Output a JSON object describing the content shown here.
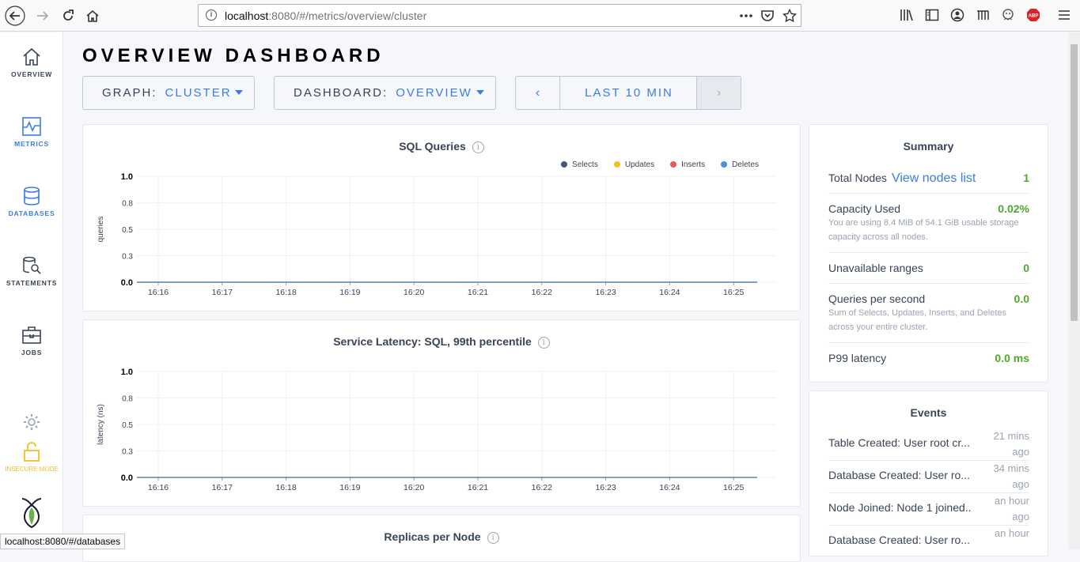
{
  "browser": {
    "url_host": "localhost",
    "url_rest": ":8080/#/metrics/overview/cluster",
    "status_url": "localhost:8080/#/databases"
  },
  "sidebar": {
    "items": [
      {
        "label": "OVERVIEW",
        "icon": "home-icon"
      },
      {
        "label": "METRICS",
        "icon": "metrics-icon"
      },
      {
        "label": "DATABASES",
        "icon": "database-icon"
      },
      {
        "label": "STATEMENTS",
        "icon": "statements-icon"
      },
      {
        "label": "JOBS",
        "icon": "jobs-icon"
      }
    ],
    "insecure_label": "INSECURE MODE"
  },
  "header": {
    "title": "OVERVIEW DASHBOARD",
    "graph_key": "GRAPH:",
    "graph_value": "CLUSTER",
    "dashboard_key": "DASHBOARD:",
    "dashboard_value": "OVERVIEW",
    "time_label": "LAST 10 MIN"
  },
  "charts": {
    "sql_title": "SQL Queries",
    "latency_title": "Service Latency: SQL, 99th percentile",
    "replicas_title": "Replicas per Node"
  },
  "summary": {
    "title": "Summary",
    "total_nodes_label": "Total Nodes",
    "view_nodes_link": "View nodes list",
    "total_nodes_value": "1",
    "capacity_label": "Capacity Used",
    "capacity_value": "0.02%",
    "capacity_desc": "You are using 8.4 MiB of 54.1 GiB usable storage capacity across all nodes.",
    "unavailable_label": "Unavailable ranges",
    "unavailable_value": "0",
    "qps_label": "Queries per second",
    "qps_value": "0.0",
    "qps_desc": "Sum of Selects, Updates, Inserts, and Deletes across your entire cluster.",
    "p99_label": "P99 latency",
    "p99_value": "0.0 ms"
  },
  "events": {
    "title": "Events",
    "items": [
      {
        "text": "Table Created: User root cr...",
        "ago1": "21 mins",
        "ago2": "ago"
      },
      {
        "text": "Database Created: User ro...",
        "ago1": "34 mins",
        "ago2": "ago"
      },
      {
        "text": "Node Joined: Node 1 joined...",
        "ago1": "an hour",
        "ago2": "ago"
      },
      {
        "text": "Database Created: User ro...",
        "ago1": "an hour",
        "ago2": ""
      }
    ]
  },
  "colors": {
    "selects": "#475872",
    "updates": "#f2be2c",
    "inserts": "#e8575b",
    "deletes": "#4a90d9",
    "accent": "#3a7de1",
    "good": "#52a52e"
  },
  "chart_data": [
    {
      "type": "line",
      "title": "SQL Queries",
      "ylabel": "queries",
      "x": [
        "16:16",
        "16:17",
        "16:18",
        "16:19",
        "16:20",
        "16:21",
        "16:22",
        "16:23",
        "16:24",
        "16:25"
      ],
      "yticks": [
        "1.0",
        "0.8",
        "0.5",
        "0.3",
        "0.0"
      ],
      "ylim": [
        0,
        1
      ],
      "series": [
        {
          "name": "Selects",
          "values": [
            0,
            0,
            0,
            0,
            0,
            0,
            0,
            0,
            0,
            0
          ]
        },
        {
          "name": "Updates",
          "values": [
            0,
            0,
            0,
            0,
            0,
            0,
            0,
            0,
            0,
            0
          ]
        },
        {
          "name": "Inserts",
          "values": [
            0,
            0,
            0,
            0,
            0,
            0,
            0,
            0,
            0,
            0
          ]
        },
        {
          "name": "Deletes",
          "values": [
            0,
            0,
            0,
            0,
            0,
            0,
            0,
            0,
            0,
            0
          ]
        }
      ],
      "legend": "top-right",
      "grid": true
    },
    {
      "type": "line",
      "title": "Service Latency: SQL, 99th percentile",
      "ylabel": "latency (ns)",
      "x": [
        "16:16",
        "16:17",
        "16:18",
        "16:19",
        "16:20",
        "16:21",
        "16:22",
        "16:23",
        "16:24",
        "16:25"
      ],
      "yticks": [
        "1.0",
        "0.8",
        "0.5",
        "0.3",
        "0.0"
      ],
      "ylim": [
        0,
        1
      ],
      "series": [
        {
          "values": [
            0,
            0,
            0,
            0,
            0,
            0,
            0,
            0,
            0,
            0
          ]
        }
      ],
      "grid": true
    }
  ]
}
